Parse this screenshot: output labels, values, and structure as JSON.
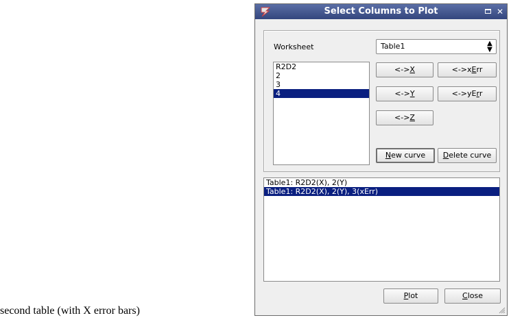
{
  "caption": "second table (with X error bars)",
  "window": {
    "title": "Select Columns to Plot",
    "maximize_icon": "maximize-icon",
    "close_icon": "close-icon",
    "close_glyph": "✕"
  },
  "worksheet": {
    "label": "Worksheet",
    "selected": "Table1",
    "combo_arrows": "▲▼"
  },
  "columns": {
    "items": [
      "R2D2",
      "2",
      "3",
      "4"
    ],
    "selected_index": 3
  },
  "buttons": {
    "x": {
      "prefix": "<->",
      "acc": "X",
      "suffix": ""
    },
    "xerr": {
      "prefix": "<->x",
      "acc": "E",
      "suffix": "rr"
    },
    "y": {
      "prefix": "<->",
      "acc": "Y",
      "suffix": ""
    },
    "yerr": {
      "prefix": "<->yE",
      "acc": "r",
      "suffix": "r"
    },
    "z": {
      "prefix": "<->",
      "acc": "Z",
      "suffix": ""
    },
    "new_curve": {
      "prefix": "",
      "acc": "N",
      "suffix": "ew curve"
    },
    "delete_curve": {
      "prefix": "",
      "acc": "D",
      "suffix": "elete curve"
    },
    "plot": {
      "prefix": "",
      "acc": "P",
      "suffix": "lot"
    },
    "close": {
      "prefix": "",
      "acc": "C",
      "suffix": "lose"
    }
  },
  "curves": {
    "items": [
      "Table1: R2D2(X), 2(Y)",
      "Table1: R2D2(X), 2(Y), 3(xErr)"
    ],
    "selected_index": 1
  },
  "colors": {
    "selection": "#0a1f80",
    "titlebar": "#3c4f88"
  }
}
